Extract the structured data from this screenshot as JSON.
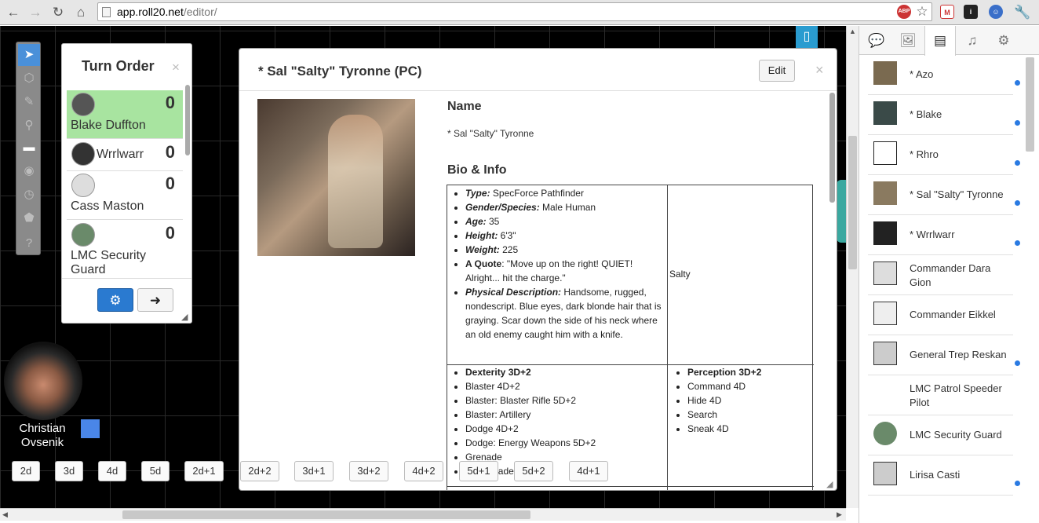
{
  "browser": {
    "url_host": "app.roll20.net",
    "url_path": "/editor/",
    "ext_abp": "ABP"
  },
  "turn_order": {
    "title": "Turn Order",
    "entries": [
      {
        "name": "Blake Duffton",
        "initiative": "0",
        "current": true
      },
      {
        "name": "Wrrlwarr",
        "initiative": "0",
        "current": false
      },
      {
        "name": "Cass Maston",
        "initiative": "0",
        "current": false
      },
      {
        "name": "LMC Security Guard",
        "initiative": "0",
        "current": false
      }
    ]
  },
  "token": {
    "name": "Christian Ovsenik"
  },
  "dice_buttons": [
    "2d",
    "3d",
    "4d",
    "5d",
    "2d+1",
    "2d+2",
    "3d+1",
    "3d+2",
    "4d+2",
    "5d+1",
    "5d+2",
    "4d+1"
  ],
  "modal": {
    "title": "* Sal \"Salty\" Tyronne (PC)",
    "edit_label": "Edit",
    "close_glyph": "×",
    "name_heading": "Name",
    "name_value": "* Sal \"Salty\" Tyronne",
    "bio_heading": "Bio & Info",
    "bio": [
      {
        "label": "Type:",
        "value": " SpecForce Pathfinder"
      },
      {
        "label": "Gender/Species:",
        "value": " Male Human"
      },
      {
        "label": "Age:",
        "value": " 35"
      },
      {
        "label": "Height:",
        "value": " 6'3\""
      },
      {
        "label": "Weight:",
        "value": " 225"
      },
      {
        "label": "A Quote",
        "value": ": \"Move up on the right! QUIET! Alright... hit the charge.\""
      },
      {
        "label": "Physical Description:",
        "value": " Handsome, rugged, nondescript. Blue eyes, dark blonde hair that is graying. Scar down the side of his neck where an old enemy caught him with a knife."
      }
    ],
    "nickname": "Salty",
    "dexterity": {
      "header": "Dexterity 3D+2",
      "skills": [
        "Blaster 4D+2",
        "Blaster: Blaster Rifle 5D+2",
        "Blaster: Artillery",
        "Dodge 4D+2",
        "Dodge: Energy Weapons 5D+2",
        "Grenade",
        "Vibro Blade"
      ]
    },
    "perception": {
      "header": "Perception 3D+2",
      "skills": [
        "Command 4D",
        "Hide 4D",
        "Search",
        "Sneak 4D"
      ]
    }
  },
  "journal": {
    "items": [
      {
        "name": "* Azo",
        "dot": true
      },
      {
        "name": "* Blake",
        "dot": true
      },
      {
        "name": "* Rhro",
        "dot": true
      },
      {
        "name": "* Sal \"Salty\" Tyronne",
        "dot": true
      },
      {
        "name": "* Wrrlwarr",
        "dot": true
      },
      {
        "name": "Commander Dara Gion",
        "dot": false
      },
      {
        "name": "Commander Eikkel",
        "dot": false
      },
      {
        "name": "General Trep Reskan",
        "dot": true
      },
      {
        "name": "LMC Patrol Speeder Pilot",
        "dot": false
      },
      {
        "name": "LMC Security Guard",
        "dot": false
      },
      {
        "name": "Lirisa Casti",
        "dot": true
      }
    ]
  }
}
